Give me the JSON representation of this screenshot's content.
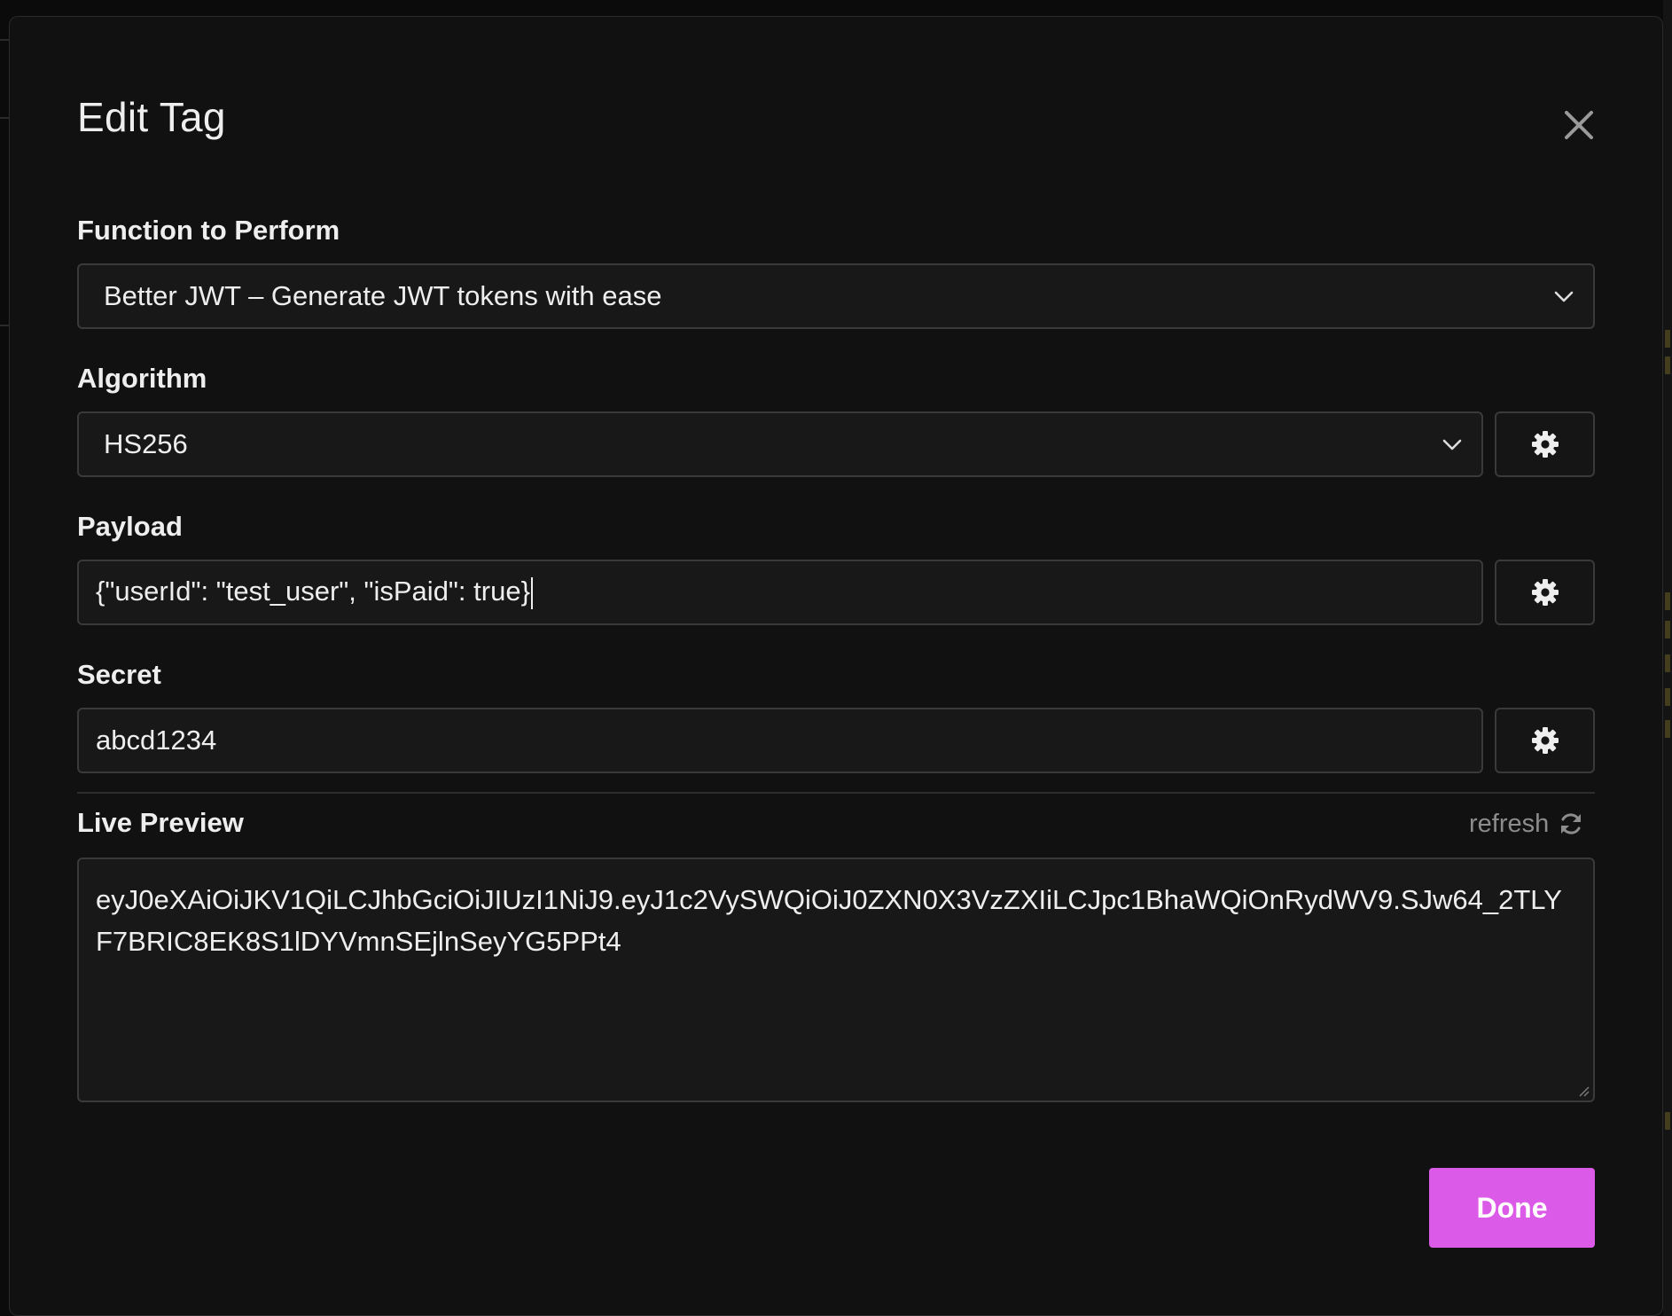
{
  "modal": {
    "title": "Edit Tag",
    "close_icon": "close-icon"
  },
  "function": {
    "label": "Function to Perform",
    "value": "Better JWT – Generate JWT tokens with ease"
  },
  "algorithm": {
    "label": "Algorithm",
    "value": "HS256"
  },
  "payload": {
    "label": "Payload",
    "value": "{\"userId\": \"test_user\", \"isPaid\": true}"
  },
  "secret": {
    "label": "Secret",
    "value": "abcd1234"
  },
  "live_preview": {
    "label": "Live Preview",
    "refresh_label": "refresh",
    "value": "eyJ0eXAiOiJKV1QiLCJhbGciOiJIUzI1NiJ9.eyJ1c2VySWQiOiJ0ZXN0X3VzZXIiLCJpc1BhaWQiOnRydWV9.SJw64_2TLYF7BRIC8EK8S1lDYVmnSEjlnSeyYG5PPt4"
  },
  "footer": {
    "done_label": "Done"
  },
  "colors": {
    "accent": "#dc5ae8",
    "modal_background": "#111111",
    "field_background": "#181818",
    "border": "#3a3a3a",
    "muted_text": "#8c8c8c"
  },
  "icons": {
    "close": "close-icon",
    "dropdown": "chevron-down-icon",
    "settings": "gear-icon",
    "refresh": "refresh-icon"
  }
}
